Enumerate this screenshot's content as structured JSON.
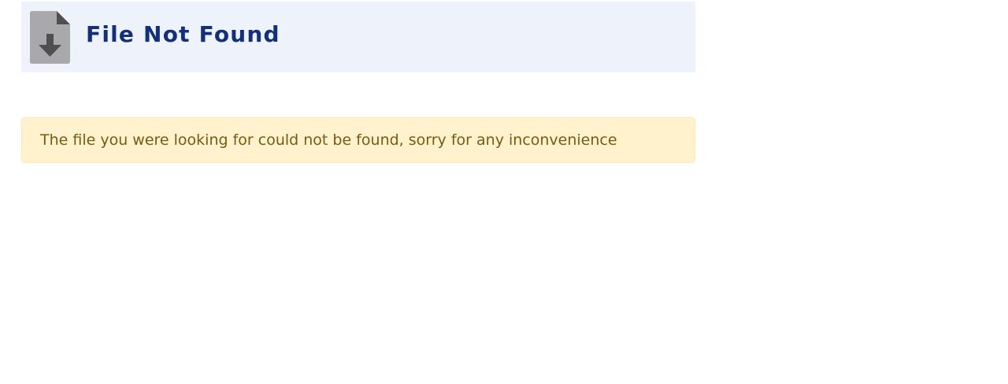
{
  "header": {
    "title": "File Not Found",
    "icon": "file-download-icon",
    "background_color": "#eef3fb",
    "title_color": "#14307a"
  },
  "alert": {
    "message": "The file you were looking for could not be found, sorry for any inconvenience",
    "background_color": "#fff2cc",
    "text_color": "#7a5a12"
  }
}
